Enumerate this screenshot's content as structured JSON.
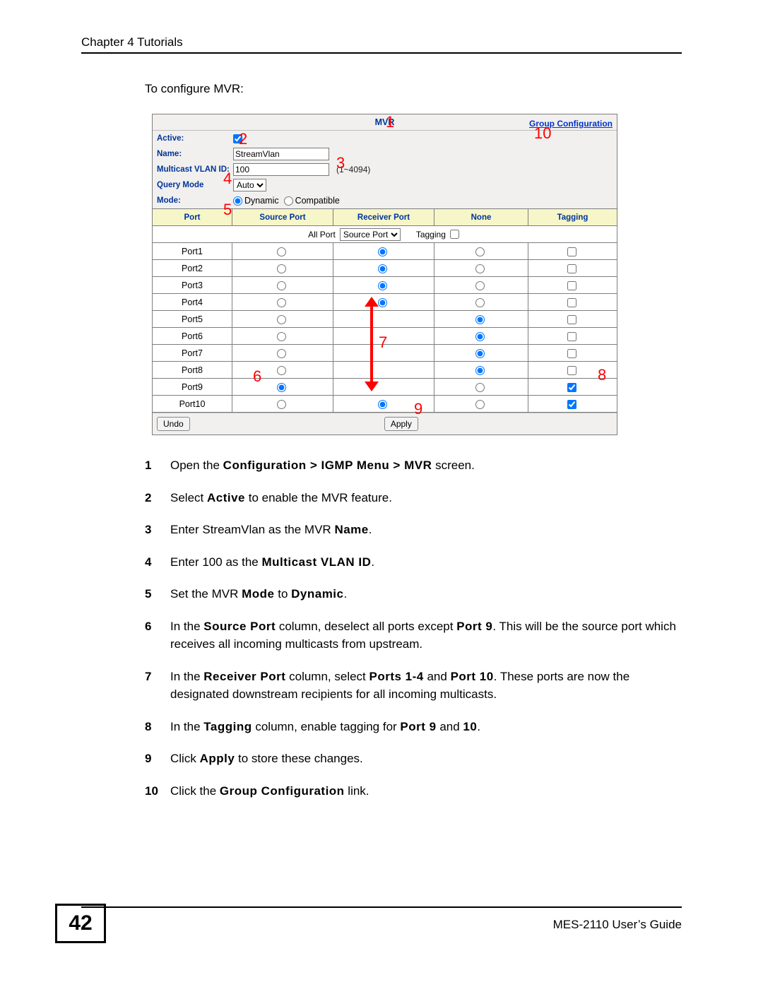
{
  "header": "Chapter 4 Tutorials",
  "intro": "To configure MVR:",
  "panel": {
    "title": "MVR",
    "group_link": "Group Configuration",
    "labels": {
      "active": "Active:",
      "name": "Name:",
      "vlan": "Multicast VLAN ID:",
      "query": "Query Mode",
      "mode": "Mode:"
    },
    "values": {
      "name": "StreamVlan",
      "vlan": "100",
      "vlan_hint": "(1~4094)",
      "query": "Auto",
      "mode_dynamic": "Dynamic",
      "mode_compatible": "Compatible"
    },
    "columns": [
      "Port",
      "Source Port",
      "Receiver Port",
      "None",
      "Tagging"
    ],
    "allport": {
      "label": "All Port",
      "select": "Source Port",
      "tagging": "Tagging"
    },
    "ports": [
      {
        "name": "Port1",
        "sel": "receiver",
        "tag": false
      },
      {
        "name": "Port2",
        "sel": "receiver",
        "tag": false
      },
      {
        "name": "Port3",
        "sel": "receiver",
        "tag": false
      },
      {
        "name": "Port4",
        "sel": "receiver",
        "tag": false
      },
      {
        "name": "Port5",
        "sel": "none",
        "tag": false
      },
      {
        "name": "Port6",
        "sel": "none",
        "tag": false
      },
      {
        "name": "Port7",
        "sel": "none",
        "tag": false
      },
      {
        "name": "Port8",
        "sel": "none",
        "tag": false
      },
      {
        "name": "Port9",
        "sel": "source",
        "tag": true
      },
      {
        "name": "Port10",
        "sel": "receiver",
        "tag": true
      }
    ],
    "undo": "Undo",
    "apply": "Apply"
  },
  "annot": {
    "a1": "1",
    "a2": "2",
    "a3": "3",
    "a4": "4",
    "a5": "5",
    "a6": "6",
    "a7": "7",
    "a8": "8",
    "a9": "9",
    "a10": "10"
  },
  "steps": [
    {
      "n": "1",
      "html": "Open the <b class='bold'>Configuration > IGMP Menu > MVR</b> screen."
    },
    {
      "n": "2",
      "html": "Select <b class='bold'>Active</b> to enable the MVR feature."
    },
    {
      "n": "3",
      "html": "Enter StreamVlan as the MVR <b class='bold'>Name</b>."
    },
    {
      "n": "4",
      "html": "Enter 100 as the <b class='bold'>Multicast VLAN ID</b>."
    },
    {
      "n": "5",
      "html": "Set the MVR <b class='bold'>Mode</b> to <b class='bold'>Dynamic</b>."
    },
    {
      "n": "6",
      "html": "In the <b class='bold'>Source Port</b> column, deselect all ports except <b class='bold'>Port 9</b>. This will be the source port which receives all incoming multicasts from upstream."
    },
    {
      "n": "7",
      "html": "In the <b class='bold'>Receiver Port</b> column, select <b class='bold'>Ports 1-4</b> and <b class='bold'>Port 10</b>. These ports are now the designated downstream recipients for all incoming multicasts."
    },
    {
      "n": "8",
      "html": "In the <b class='bold'>Tagging</b> column, enable tagging for <b class='bold'>Port 9</b> and <b class='bold'>10</b>."
    },
    {
      "n": "9",
      "html": "Click <b class='bold'>Apply</b> to store these changes."
    },
    {
      "n": "10",
      "html": "Click the <b class='bold'>Group Configuration</b> link."
    }
  ],
  "footer": {
    "page": "42",
    "guide": "MES-2110 User’s Guide"
  }
}
